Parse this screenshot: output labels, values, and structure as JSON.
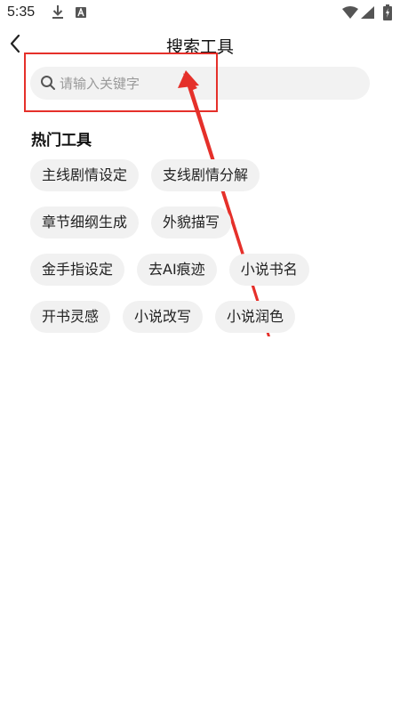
{
  "status_bar": {
    "time": "5:35",
    "icons": [
      "download-icon",
      "app-notification-icon",
      "wifi-icon",
      "signal-icon",
      "battery-charging-icon"
    ]
  },
  "header": {
    "title": "搜索工具",
    "back_icon": "chevron-left-icon"
  },
  "search": {
    "placeholder": "请输入关键字",
    "value": "",
    "icon": "search-icon"
  },
  "hot_tools": {
    "title": "热门工具",
    "rows": [
      [
        "主线剧情设定",
        "支线剧情分解"
      ],
      [
        "章节细纲生成",
        "外貌描写"
      ],
      [
        "金手指设定",
        "去AI痕迹",
        "小说书名"
      ],
      [
        "开书灵感",
        "小说改写",
        "小说润色"
      ]
    ]
  },
  "colors": {
    "annotation": "#e5302a",
    "chip_background": "#f1f1f1",
    "search_background": "#f2f2f2"
  }
}
